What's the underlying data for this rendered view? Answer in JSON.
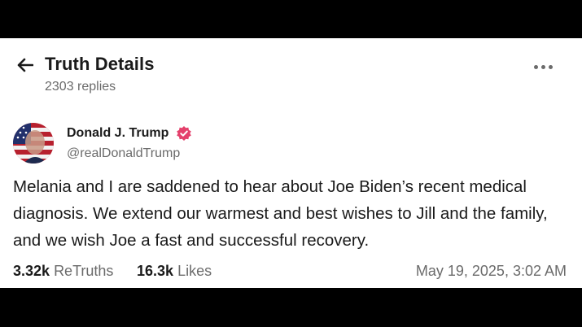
{
  "header": {
    "title": "Truth Details",
    "replies": "2303 replies"
  },
  "post": {
    "author": {
      "display_name": "Donald J. Trump",
      "handle": "@realDonaldTrump",
      "verified": true
    },
    "text": "Melania and I are saddened to hear about Joe Biden’s recent medical diagnosis. We extend our warmest and best wishes to Jill and the family, and we wish Joe a fast and successful recovery.",
    "stats": {
      "retruths_count": "3.32k",
      "retruths_label": "ReTruths",
      "likes_count": "16.3k",
      "likes_label": "Likes"
    },
    "timestamp": "May 19, 2025, 3:02 AM"
  },
  "icons": {
    "back": "arrow-left-icon",
    "more": "more-horizontal-icon",
    "verified": "verified-badge-icon"
  },
  "colors": {
    "verified_badge": "#e4416c",
    "text_primary": "#1a1a1a",
    "text_secondary": "#6b6b6b",
    "background": "#ffffff",
    "letterbox": "#000000"
  }
}
